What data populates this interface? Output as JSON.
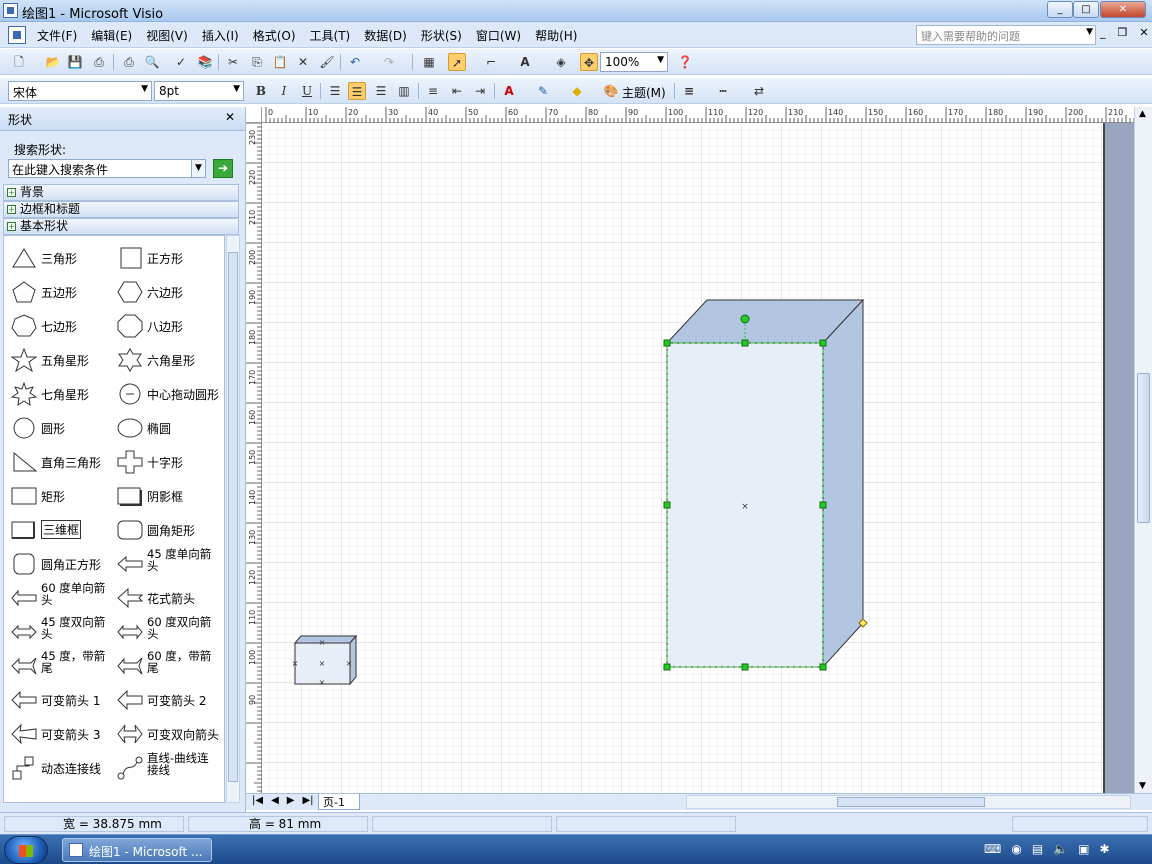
{
  "window": {
    "title": "绘图1 - Microsoft Visio",
    "min": "_",
    "max": "□",
    "close": "✕"
  },
  "menu": {
    "items": [
      "文件(F)",
      "编辑(E)",
      "视图(V)",
      "插入(I)",
      "格式(O)",
      "工具(T)",
      "数据(D)",
      "形状(S)",
      "窗口(W)",
      "帮助(H)"
    ],
    "help_placeholder": "键入需要帮助的问题"
  },
  "toolbar": {
    "zoom": "100%",
    "font": "宋体",
    "size": "8pt",
    "bold": "B",
    "italic": "I",
    "underline": "U",
    "theme": "主题(M)",
    "text_tool": "A"
  },
  "shapes_panel": {
    "title": "形状",
    "close": "✕",
    "search_label": "搜索形状:",
    "search_placeholder": "在此键入搜索条件",
    "go": "➔",
    "stencils": [
      "背景",
      "边框和标题",
      "基本形状"
    ],
    "items": [
      "三角形",
      "正方形",
      "五边形",
      "六边形",
      "七边形",
      "八边形",
      "五角星形",
      "六角星形",
      "七角星形",
      "中心拖动圆形",
      "圆形",
      "椭圆",
      "直角三角形",
      "十字形",
      "矩形",
      "阴影框",
      "三维框",
      "圆角矩形",
      "圆角正方形",
      "45 度单向箭头",
      "60 度单向箭头",
      "花式箭头",
      "45 度双向箭头",
      "60 度双向箭头",
      "45 度，带箭尾",
      "60 度，带箭尾",
      "可变箭头 1",
      "可变箭头 2",
      "可变箭头 3",
      "可变双向箭头",
      "动态连接线",
      "直线-曲线连接线"
    ],
    "selected": "三维框"
  },
  "rulers": {
    "h": [
      "0",
      "10",
      "20",
      "30",
      "40",
      "50",
      "60",
      "70",
      "80",
      "90",
      "100",
      "110",
      "120",
      "130",
      "140",
      "150",
      "160",
      "170",
      "180",
      "190",
      "200",
      "210"
    ],
    "v": [
      "230",
      "220",
      "210",
      "200",
      "190",
      "180",
      "170",
      "160",
      "150",
      "140",
      "130",
      "120",
      "110",
      "100",
      "90"
    ]
  },
  "pages": {
    "tab": "页-1",
    "nav": [
      "|◀",
      "◀",
      "▶",
      "▶|"
    ]
  },
  "status": {
    "width": "宽 = 38.875 mm",
    "height": "高 = 81 mm"
  },
  "taskbar": {
    "task": "绘图1 - Microsoft ..."
  },
  "colors": {
    "box_front": "#e7eef7",
    "box_side": "#b3c6e1",
    "box_top": "#b3c6e1",
    "handle": "#22cc22"
  }
}
